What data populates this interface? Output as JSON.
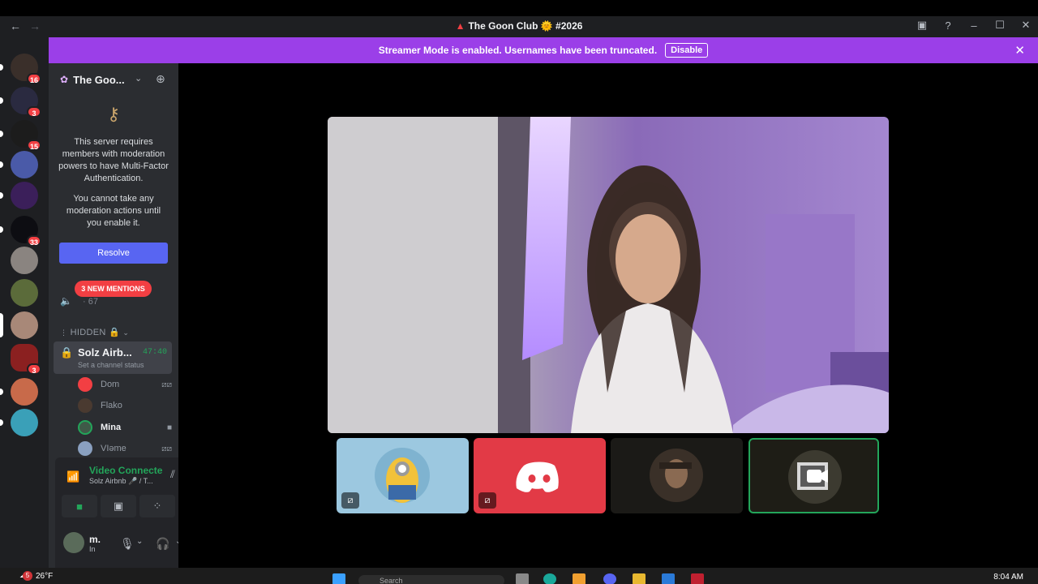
{
  "titlebar": {
    "title": "The Goon Club 🌞 #2026",
    "back_icon": "arrow-left-icon",
    "forward_icon": "arrow-right-icon"
  },
  "banner": {
    "text": "Streamer Mode is enabled. Usernames have been truncated.",
    "button": "Disable"
  },
  "server_rail": {
    "badges": [
      "16",
      "3",
      "15",
      "33",
      "3"
    ]
  },
  "sidebar": {
    "server_name": "The Goo...",
    "mfa_notice": "This server requires members with moderation powers to have Multi-Factor Authentication.",
    "mfa_notice2": "You cannot take any moderation actions until you enable it.",
    "resolve_button": "Resolve",
    "mentions_pill": "3 NEW MENTIONS",
    "voice_count": "· 67",
    "hidden_category": "HIDDEN 🔒",
    "active_channel": {
      "name": "Solz Airb...",
      "timer": "47:40",
      "status": "Set a channel status"
    },
    "voice_users": [
      {
        "name": "Dom"
      },
      {
        "name": "Flako"
      },
      {
        "name": "Mina"
      },
      {
        "name": "VIəme"
      }
    ]
  },
  "voice_panel": {
    "title": "Video Connected",
    "subtitle": "Solz Airbnb 🎤 / T...",
    "user_name": "m.",
    "user_status": "In"
  },
  "taskbar": {
    "weather_badge": "5",
    "temperature": "26°F",
    "search_placeholder": "Search",
    "clock": "8:04 AM"
  },
  "colors": {
    "accent": "#5865f2",
    "banner": "#9b3fe8",
    "online": "#23a55a",
    "danger": "#f23f43"
  }
}
